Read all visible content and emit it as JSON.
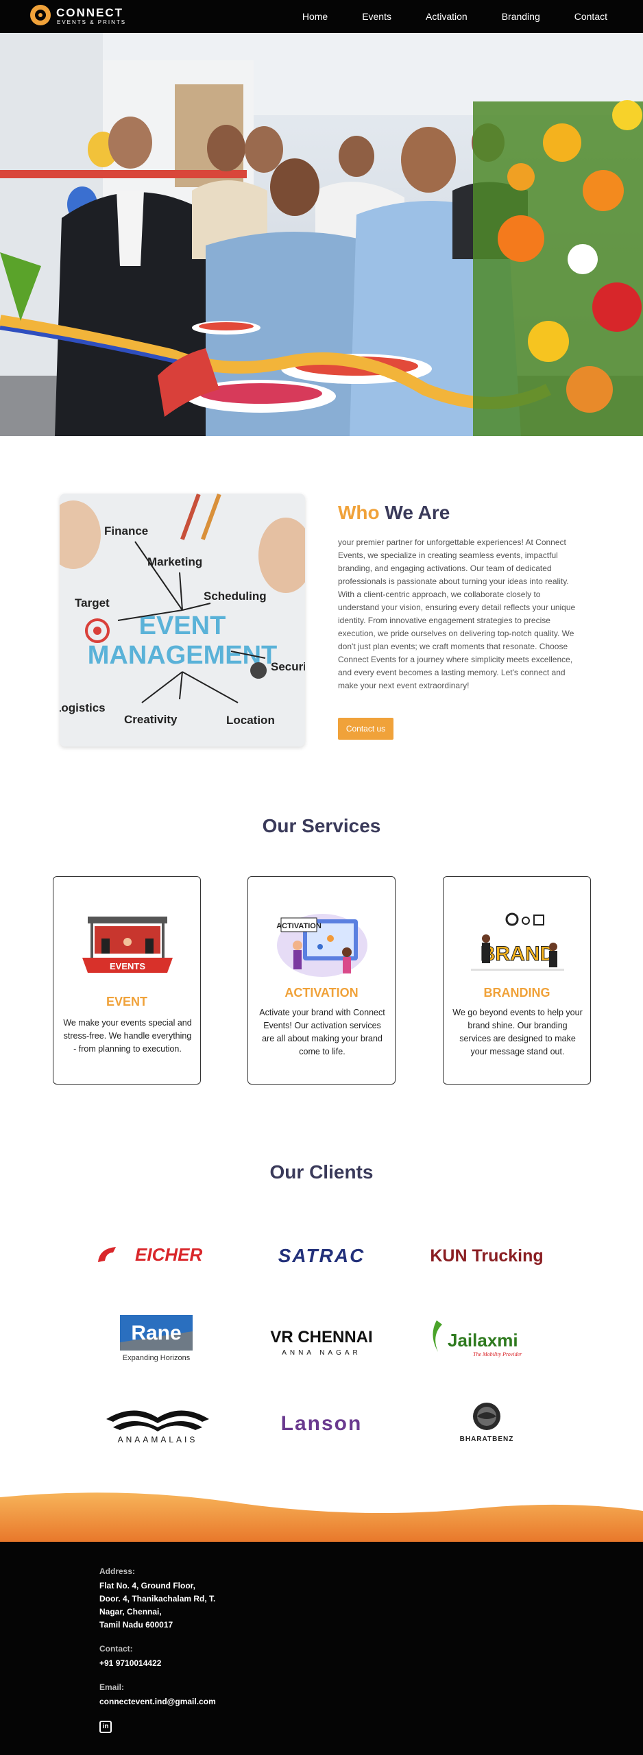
{
  "nav": {
    "logo_name": "CONNECT",
    "logo_sub": "EVENTS & PRINTS",
    "links": [
      "Home",
      "Events",
      "Activation",
      "Branding",
      "Contact"
    ]
  },
  "hero": {
    "slides": 2,
    "active_slide": 2
  },
  "who": {
    "title_1": "Who",
    "title_2": "We Are",
    "image_words": [
      "Finance",
      "Marketing",
      "Target",
      "Scheduling",
      "EVENT",
      "MANAGEMENT",
      "Security",
      "Logistics",
      "Creativity",
      "Location"
    ],
    "text": "your premier partner for unforgettable experiences! At Connect Events, we specialize in creating seamless events, impactful branding, and engaging activations. Our team of dedicated professionals is passionate about turning your ideas into reality. With a client-centric approach, we collaborate closely to understand your vision, ensuring every detail reflects your unique identity. From innovative engagement strategies to precise execution, we pride ourselves on delivering top-notch quality. We don't just plan events; we craft moments that resonate. Choose Connect Events for a journey where simplicity meets excellence, and every event becomes a lasting memory. Let's connect and make your next event extraordinary!",
    "button": "Contact us"
  },
  "services": {
    "title": "Our Services",
    "cards": [
      {
        "title": "EVENT",
        "image_label": "EVENTS",
        "desc": "We make your events special and stress-free. We handle everything - from planning to execution."
      },
      {
        "title": "ACTIVATION",
        "image_label": "ACTIVATION",
        "desc": "Activate your brand with Connect Events! Our activation services are all about making your brand come to life."
      },
      {
        "title": "BRANDING",
        "image_label": "BRAND",
        "desc": "We go beyond events to help your brand shine. Our branding services are designed to make your message stand out."
      }
    ]
  },
  "clients": {
    "title": "Our Clients",
    "logos": [
      {
        "name": "EICHER"
      },
      {
        "name": "SATRAC"
      },
      {
        "name": "KUN Trucking"
      },
      {
        "name": "Rane",
        "tagline": "Expanding Horizons"
      },
      {
        "name": "VR CHENNAI",
        "tagline": "ANNA NAGAR"
      },
      {
        "name": "Jailaxmi",
        "tagline": "The Mobility Provider"
      },
      {
        "name": "ANAAMALAIS"
      },
      {
        "name": "Lanson"
      },
      {
        "name": "BHARATBENZ"
      }
    ]
  },
  "footer": {
    "address_label": "Address:",
    "address": "Flat No. 4, Ground Floor,\nDoor. 4, Thanikachalam Rd, T.\nNagar, Chennai,\nTamil Nadu 600017",
    "contact_label": "Contact:",
    "phone": "+91 9710014422",
    "email_label": "Email:",
    "email": "connectevent.ind@gmail.com",
    "social": "in"
  },
  "colors": {
    "accent": "#f0a23a",
    "heading": "#3a3a5a",
    "footer_bg": "#050505"
  }
}
